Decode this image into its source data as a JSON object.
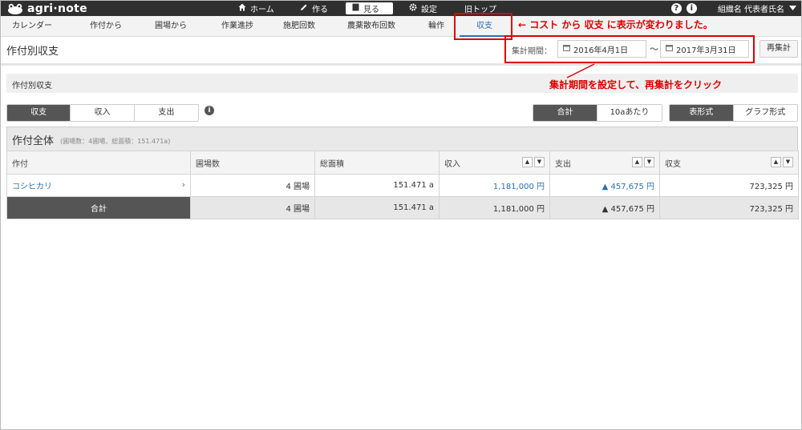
{
  "app": {
    "logo_text": "agri·note"
  },
  "topnav": {
    "home": "ホーム",
    "create": "作る",
    "view": "見る",
    "settings": "設定",
    "old_top": "旧トップ",
    "org_name": "組織名 代表者氏名",
    "help_glyph": "?",
    "info_glyph": "i"
  },
  "subnav": [
    "カレンダー",
    "作付から",
    "圃場から",
    "作業進捗",
    "施肥回数",
    "農薬散布回数",
    "輪作",
    "収支"
  ],
  "page": {
    "title": "作付別収支",
    "period_label": "集計期間：",
    "date_from": "2016年4月1日",
    "tilde": "〜",
    "date_to": "2017年3月31日",
    "recalc": "再集計"
  },
  "section": {
    "label": "作付別収支"
  },
  "annotations": {
    "tab_note": "← コスト から 収支 に表示が変わりました。",
    "period_note": "集計期間を設定して、再集計をクリック"
  },
  "toggles": {
    "type": [
      "収支",
      "収入",
      "支出"
    ],
    "type_selected": 0,
    "unit": [
      "合計",
      "10aあたり"
    ],
    "unit_selected": 0,
    "view": [
      "表形式",
      "グラフ形式"
    ],
    "view_selected": 0,
    "info_glyph": "i"
  },
  "table": {
    "title": "作付全体",
    "subtitle": "(圃場数：4圃場、総面積：151.471a)",
    "columns": [
      "作付",
      "圃場数",
      "総面積",
      "収入",
      "支出",
      "収支"
    ],
    "rows": [
      {
        "crop": "コシヒカリ",
        "fields": "4 圃場",
        "area": "151.471 a",
        "income": "1,181,000 円",
        "expense": "▲ 457,675 円",
        "balance": "723,325 円"
      }
    ],
    "total": {
      "label": "合計",
      "fields": "4 圃場",
      "area": "151.471 a",
      "income": "1,181,000 円",
      "expense": "▲ 457,675 円",
      "balance": "723,325 円"
    },
    "sort_up": "▲",
    "sort_down": "▼",
    "chevron": "›"
  },
  "colors": {
    "accent": "#2b6fb5",
    "annotation": "#e00000",
    "topbar": "#2f2f2f"
  }
}
